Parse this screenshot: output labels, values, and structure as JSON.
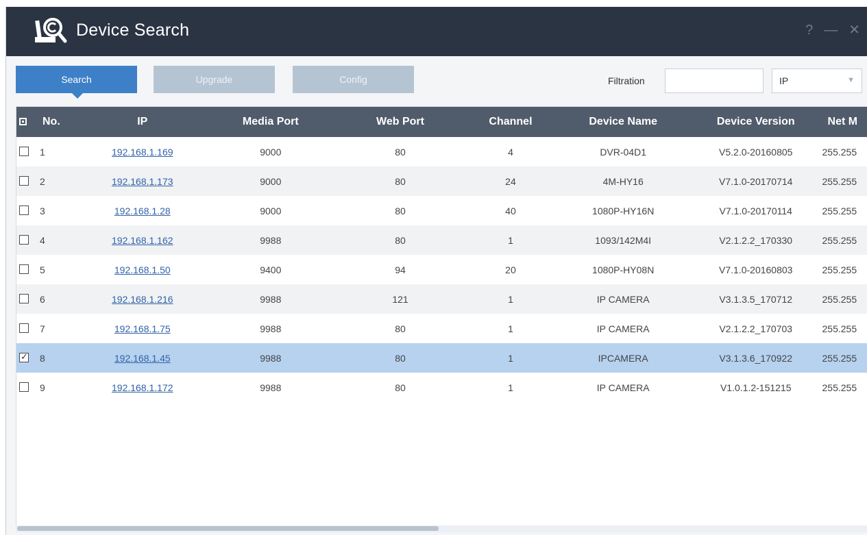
{
  "window": {
    "title": "Device Search",
    "controls": {
      "help": "?",
      "minimize": "—",
      "close": "✕"
    }
  },
  "toolbar": {
    "search_label": "Search",
    "upgrade_label": "Upgrade",
    "config_label": "Config",
    "filtration_label": "Filtration",
    "filter_value": "",
    "filter_type": "IP"
  },
  "table": {
    "headers": {
      "no": "No.",
      "ip": "IP",
      "media_port": "Media Port",
      "web_port": "Web Port",
      "channel": "Channel",
      "device_name": "Device Name",
      "device_version": "Device Version",
      "net_mask": "Net M"
    },
    "rows": [
      {
        "no": "1",
        "ip": "192.168.1.169",
        "media_port": "9000",
        "web_port": "80",
        "channel": "4",
        "device_name": "DVR-04D1",
        "device_version": "V5.2.0-20160805",
        "net_mask": "255.255",
        "checked": false
      },
      {
        "no": "2",
        "ip": "192.168.1.173",
        "media_port": "9000",
        "web_port": "80",
        "channel": "24",
        "device_name": "4M-HY16",
        "device_version": "V7.1.0-20170714",
        "net_mask": "255.255",
        "checked": false
      },
      {
        "no": "3",
        "ip": "192.168.1.28",
        "media_port": "9000",
        "web_port": "80",
        "channel": "40",
        "device_name": "1080P-HY16N",
        "device_version": "V7.1.0-20170114",
        "net_mask": "255.255",
        "checked": false
      },
      {
        "no": "4",
        "ip": "192.168.1.162",
        "media_port": "9988",
        "web_port": "80",
        "channel": "1",
        "device_name": "1093/142M4I",
        "device_version": "V2.1.2.2_170330",
        "net_mask": "255.255",
        "checked": false
      },
      {
        "no": "5",
        "ip": "192.168.1.50",
        "media_port": "9400",
        "web_port": "94",
        "channel": "20",
        "device_name": "1080P-HY08N",
        "device_version": "V7.1.0-20160803",
        "net_mask": "255.255",
        "checked": false
      },
      {
        "no": "6",
        "ip": "192.168.1.216",
        "media_port": "9988",
        "web_port": "121",
        "channel": "1",
        "device_name": "IP CAMERA",
        "device_version": "V3.1.3.5_170712",
        "net_mask": "255.255",
        "checked": false
      },
      {
        "no": "7",
        "ip": "192.168.1.75",
        "media_port": "9988",
        "web_port": "80",
        "channel": "1",
        "device_name": "IP CAMERA",
        "device_version": "V2.1.2.2_170703",
        "net_mask": "255.255",
        "checked": false
      },
      {
        "no": "8",
        "ip": "192.168.1.45",
        "media_port": "9988",
        "web_port": "80",
        "channel": "1",
        "device_name": "IPCAMERA",
        "device_version": "V3.1.3.6_170922",
        "net_mask": "255.255",
        "checked": true
      },
      {
        "no": "9",
        "ip": "192.168.1.172",
        "media_port": "9988",
        "web_port": "80",
        "channel": "1",
        "device_name": "IP CAMERA",
        "device_version": "V1.0.1.2-151215",
        "net_mask": "255.255",
        "checked": false
      }
    ]
  },
  "colors": {
    "titlebar": "#2b3443",
    "primary_button": "#3d80c8",
    "disabled_button": "#b5c4d3",
    "table_header": "#505b6b",
    "selected_row": "#b6d2ef",
    "link": "#2f62a8"
  }
}
